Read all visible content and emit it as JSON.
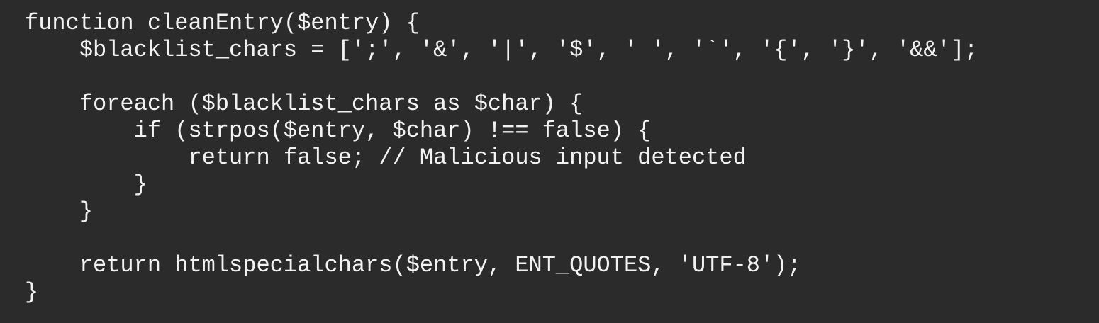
{
  "code": {
    "language": "php",
    "lines": [
      "function cleanEntry($entry) {",
      "    $blacklist_chars = [';', '&', '|', '$', ' ', '`', '{', '}', '&&'];",
      "",
      "    foreach ($blacklist_chars as $char) {",
      "        if (strpos($entry, $char) !== false) {",
      "            return false; // Malicious input detected",
      "        }",
      "    }",
      "",
      "    return htmlspecialchars($entry, ENT_QUOTES, 'UTF-8');",
      "}"
    ]
  },
  "colors": {
    "background": "#2b2b2b",
    "text": "#f2f2f2"
  }
}
